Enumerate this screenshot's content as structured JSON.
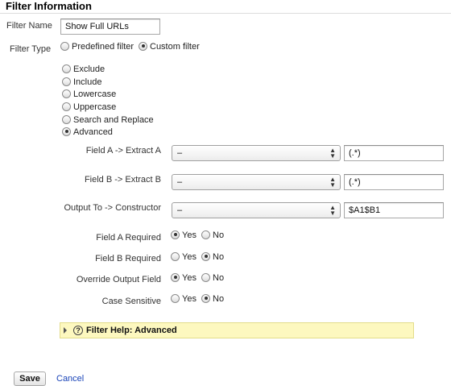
{
  "section": {
    "title": "Filter Information"
  },
  "filter_name": {
    "label": "Filter Name",
    "value": "Show Full URLs"
  },
  "filter_type": {
    "label": "Filter Type",
    "options": [
      "Predefined filter",
      "Custom filter"
    ],
    "selected": "Custom filter"
  },
  "custom_types": {
    "options": [
      "Exclude",
      "Include",
      "Lowercase",
      "Uppercase",
      "Search and Replace",
      "Advanced"
    ],
    "selected": "Advanced"
  },
  "fields": {
    "field_a": {
      "label": "Field A -> Extract A",
      "select": "–",
      "value": "(.*)"
    },
    "field_b": {
      "label": "Field B -> Extract B",
      "select": "–",
      "value": "(.*)"
    },
    "output": {
      "label": "Output To -> Constructor",
      "select": "–",
      "value": "$A1$B1"
    }
  },
  "toggles": {
    "yes_label": "Yes",
    "no_label": "No",
    "field_a_required": {
      "label": "Field A Required",
      "value": "Yes"
    },
    "field_b_required": {
      "label": "Field B Required",
      "value": "No"
    },
    "override_output": {
      "label": "Override Output Field",
      "value": "Yes"
    },
    "case_sensitive": {
      "label": "Case Sensitive",
      "value": "No"
    }
  },
  "help": {
    "icon": "question-icon",
    "label": "Filter Help: Advanced"
  },
  "actions": {
    "save": "Save",
    "cancel": "Cancel"
  },
  "colors": {
    "help_bg": "#fdf8bf",
    "link": "#1a44b8"
  }
}
